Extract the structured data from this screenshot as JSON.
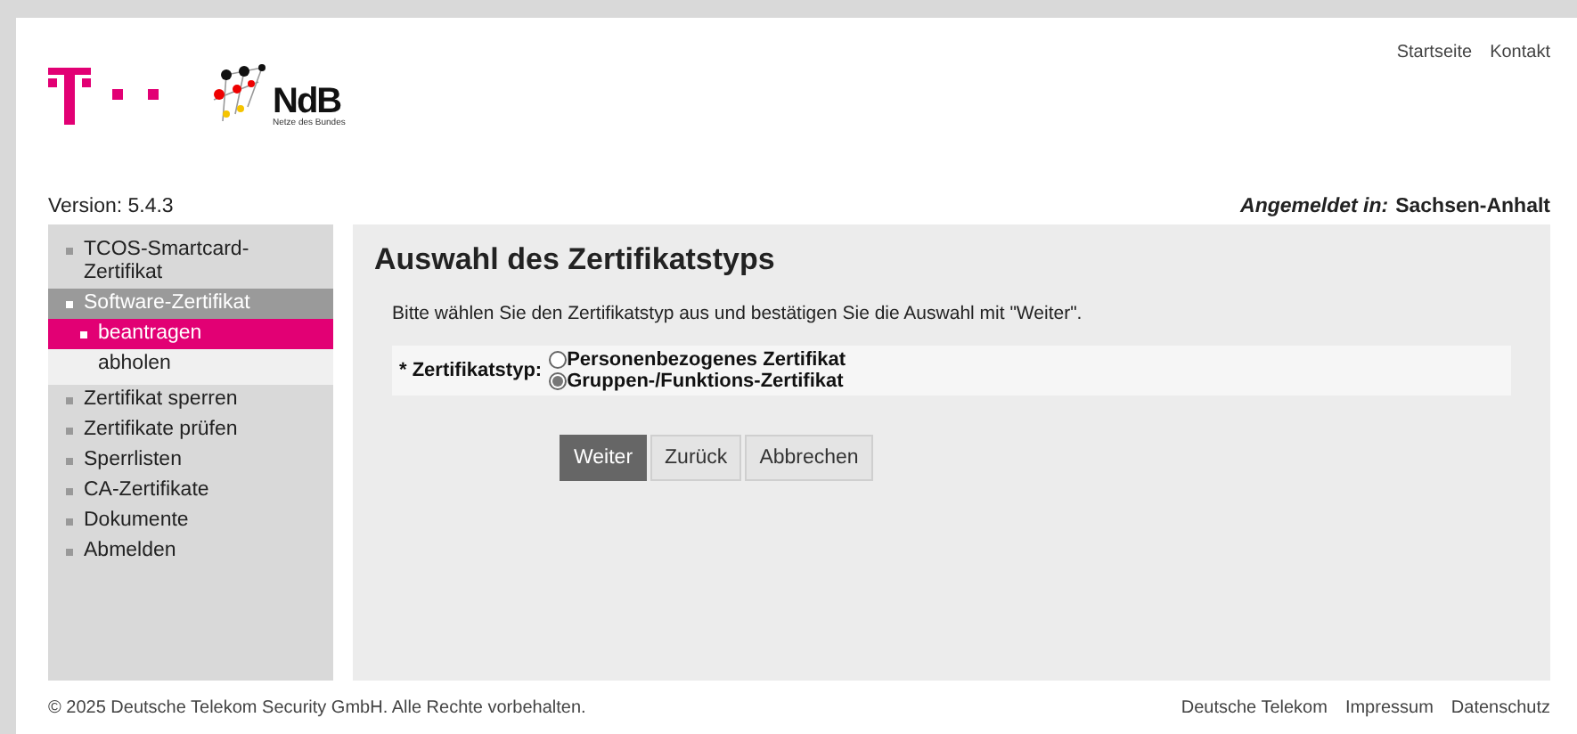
{
  "header": {
    "logo_text": "NdB",
    "logo_subtitle": "Netze des Bundes",
    "links": [
      {
        "label": "Startseite"
      },
      {
        "label": "Kontakt"
      }
    ]
  },
  "version": "Version: 5.4.3",
  "login": {
    "label": "Angemeldet in:",
    "value": "Sachsen-Anhalt"
  },
  "sidebar": {
    "items": [
      {
        "label": "TCOS-Smartcard-Zertifikat",
        "selected": false
      },
      {
        "label": "Software-Zertifikat",
        "selected": true,
        "children": [
          {
            "label": "beantragen",
            "selected": true
          },
          {
            "label": "abholen",
            "selected": false
          }
        ]
      },
      {
        "label": "Zertifikat sperren",
        "selected": false
      },
      {
        "label": "Zertifikate prüfen",
        "selected": false
      },
      {
        "label": "Sperrlisten",
        "selected": false
      },
      {
        "label": "CA-Zertifikate",
        "selected": false
      },
      {
        "label": "Dokumente",
        "selected": false
      },
      {
        "label": "Abmelden",
        "selected": false
      }
    ]
  },
  "main": {
    "title": "Auswahl des Zertifikatstyps",
    "instruction": "Bitte wählen Sie den Zertifikatstyp aus und bestätigen Sie die Auswahl mit \"Weiter\".",
    "field_label": "* Zertifikatstyp:",
    "options": [
      {
        "label": "Personenbezogenes Zertifikat",
        "selected": false
      },
      {
        "label": "Gruppen-/Funktions-Zertifikat",
        "selected": true
      }
    ],
    "buttons": [
      {
        "label": "Weiter",
        "kind": "primary"
      },
      {
        "label": "Zurück",
        "kind": "secondary"
      },
      {
        "label": "Abbrechen",
        "kind": "secondary"
      }
    ]
  },
  "footer": {
    "copyright": "© 2025 Deutsche Telekom Security GmbH. Alle Rechte vorbehalten.",
    "links": [
      {
        "label": "Deutsche Telekom"
      },
      {
        "label": "Impressum"
      },
      {
        "label": "Datenschutz"
      }
    ]
  }
}
